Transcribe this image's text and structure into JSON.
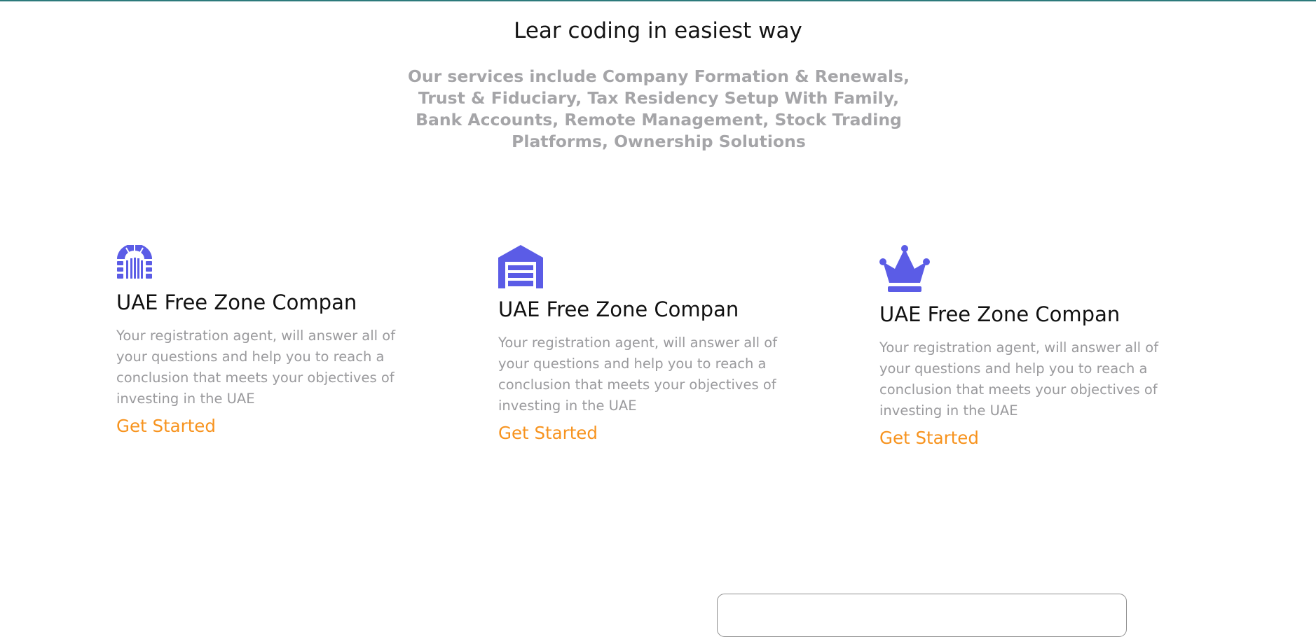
{
  "colors": {
    "accent_icon": "#5b5ce6",
    "link": "#f7931e",
    "title": "#111111",
    "muted_text": "#9a9a9d",
    "top_line": "#2c7a7b"
  },
  "header": {
    "title": "Lear coding in easiest way",
    "intro": "Our services include Company Formation & Renewals, Trust & Fiduciary, Tax Residency Setup With Family, Bank Accounts, Remote Management, Stock Trading Platforms, Ownership Solutions"
  },
  "cards": [
    {
      "icon": "archway-icon",
      "title": "UAE Free Zone Compan",
      "description": "Your registration agent, will answer all of your questions and help you to reach a conclusion that meets your objectives of investing in the UAE",
      "link": "Get Started"
    },
    {
      "icon": "warehouse-icon",
      "title": "UAE Free Zone Compan",
      "description": "Your registration agent, will answer all of your questions and help you to reach a conclusion that meets your objectives of investing in the UAE",
      "link": "Get Started"
    },
    {
      "icon": "crown-icon",
      "title": "UAE Free Zone Compan",
      "description": "Your registration agent, will answer all of your questions and help you to reach a conclusion that meets your objectives of investing in the UAE",
      "link": "Get Started"
    }
  ]
}
